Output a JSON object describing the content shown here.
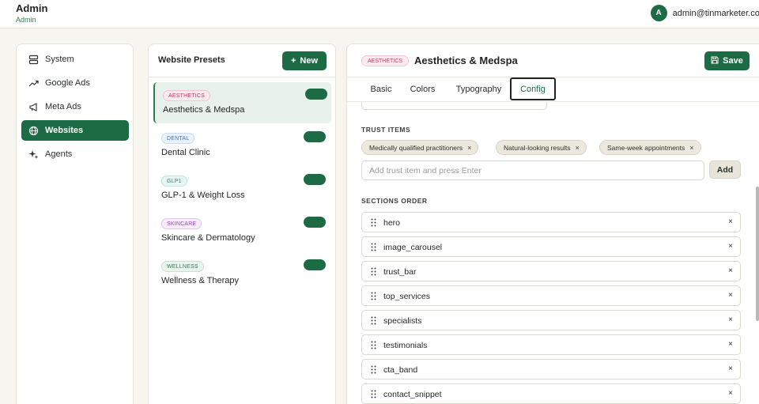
{
  "header": {
    "title": "Admin",
    "subtitle": "Admin",
    "user_initial": "A",
    "user_email": "admin@tinmarketer.com"
  },
  "nav": {
    "items": [
      {
        "label": "System",
        "icon": "server-icon",
        "active": false
      },
      {
        "label": "Google Ads",
        "icon": "trend-icon",
        "active": false
      },
      {
        "label": "Meta Ads",
        "icon": "megaphone-icon",
        "active": false
      },
      {
        "label": "Websites",
        "icon": "globe-icon",
        "active": true
      },
      {
        "label": "Agents",
        "icon": "sparkle-icon",
        "active": false
      }
    ]
  },
  "presets": {
    "title": "Website Presets",
    "new_label": "New",
    "items": [
      {
        "badge": "AESTHETICS",
        "name": "Aesthetics & Medspa",
        "badge_bg": "#fdecef",
        "badge_fg": "#c43c5c",
        "badge_border": "#f4c6d1",
        "enabled": true,
        "active": true
      },
      {
        "badge": "DENTAL",
        "name": "Dental Clinic",
        "badge_bg": "#eaf2fd",
        "badge_fg": "#3f6fb8",
        "badge_border": "#c8daf4",
        "enabled": true,
        "active": false
      },
      {
        "badge": "GLP1",
        "name": "GLP-1 & Weight Loss",
        "badge_bg": "#e6f6f3",
        "badge_fg": "#2a8a78",
        "badge_border": "#bfe5dc",
        "enabled": true,
        "active": false
      },
      {
        "badge": "SKINCARE",
        "name": "Skincare & Dermatology",
        "badge_bg": "#f6ecfb",
        "badge_fg": "#9a4bb8",
        "badge_border": "#e2c8ef",
        "enabled": true,
        "active": false
      },
      {
        "badge": "WELLNESS",
        "name": "Wellness & Therapy",
        "badge_bg": "#eaf6ec",
        "badge_fg": "#2e7d4f",
        "badge_border": "#c5e3cc",
        "enabled": true,
        "active": false
      }
    ]
  },
  "editor": {
    "badge": "AESTHETICS",
    "title": "Aesthetics & Medspa",
    "save_label": "Save",
    "tabs": [
      "Basic",
      "Colors",
      "Typography",
      "Config"
    ],
    "active_tab": "Config",
    "trust_label": "TRUST ITEMS",
    "trust_items": [
      "Medically qualified practitioners",
      "Natural-looking results",
      "Same-week appointments"
    ],
    "trust_placeholder": "Add trust item and press Enter",
    "add_label": "Add",
    "sections_label": "SECTIONS ORDER",
    "sections": [
      "hero",
      "image_carousel",
      "trust_bar",
      "top_services",
      "specialists",
      "testimonials",
      "cta_band",
      "contact_snippet"
    ],
    "remove_glyph": "×",
    "chip_remove_glyph": "×"
  },
  "colors": {
    "brand": "#1c6b45",
    "background": "#f7f5ef"
  }
}
